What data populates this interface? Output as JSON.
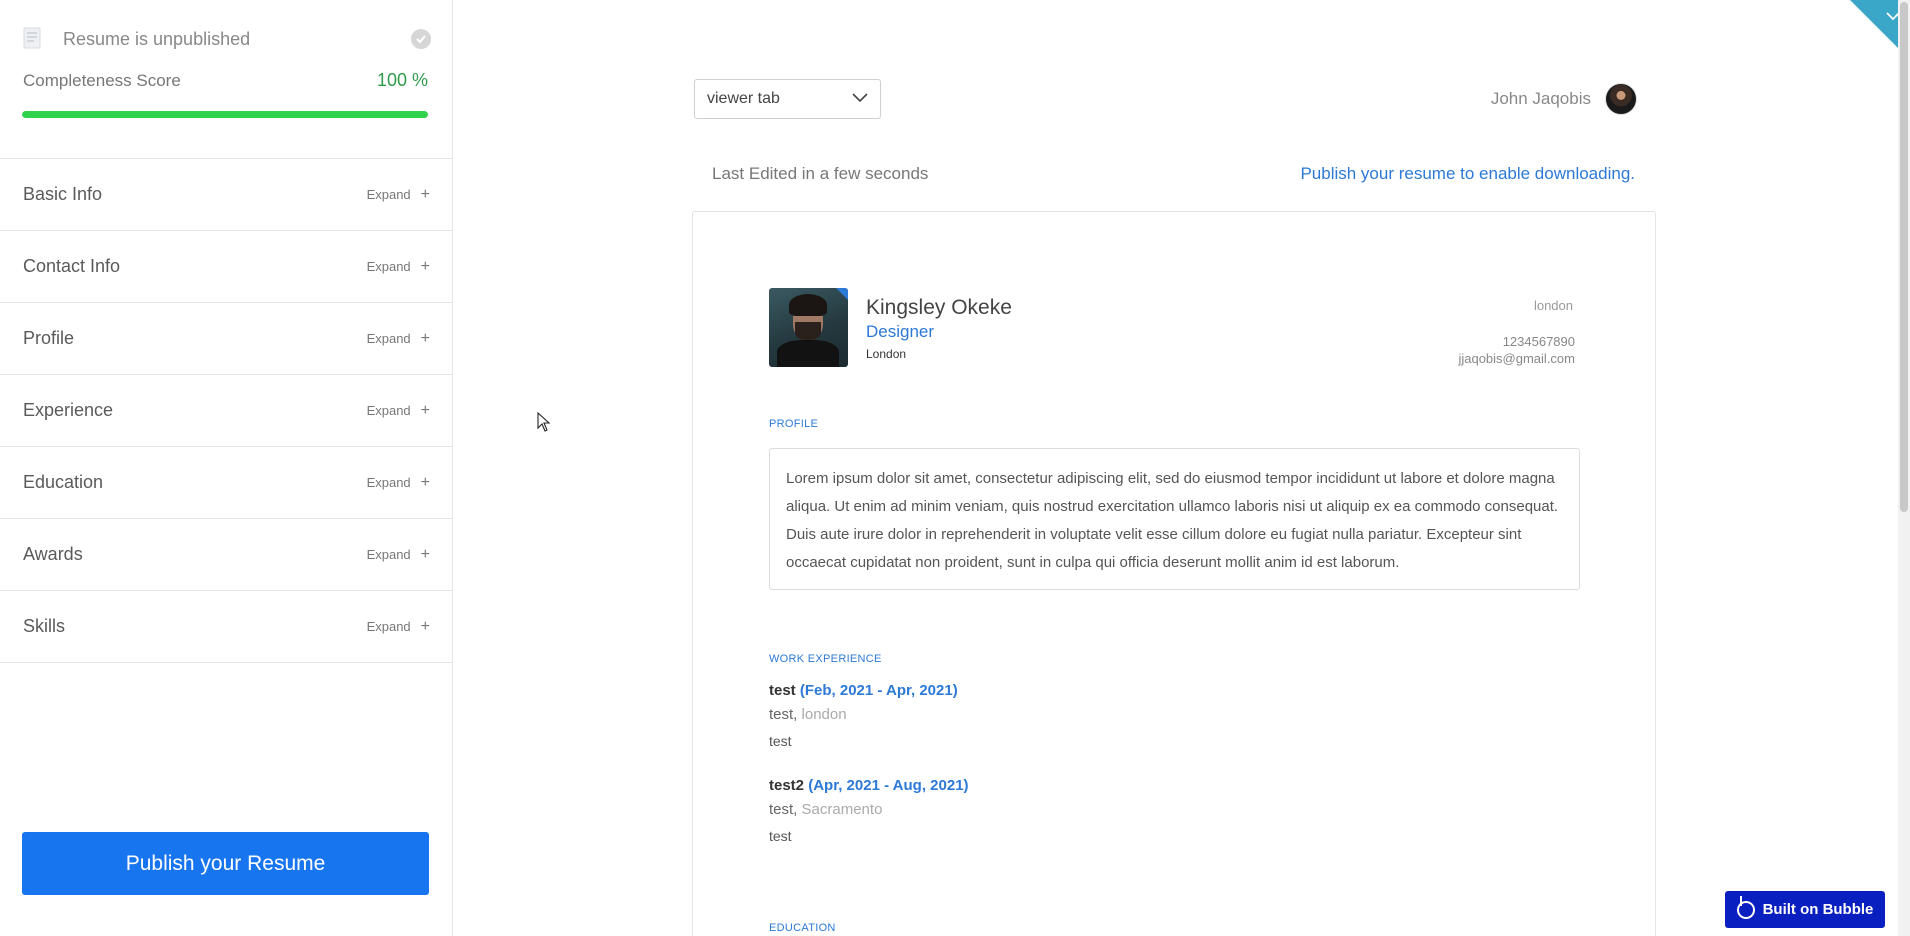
{
  "sidebar": {
    "status_text": "Resume is unpublished",
    "score_label": "Completeness Score",
    "score_value": "100 %",
    "score_fraction": 1.0,
    "sections": [
      {
        "label": "Basic Info",
        "expand": "Expand"
      },
      {
        "label": "Contact Info",
        "expand": "Expand"
      },
      {
        "label": "Profile",
        "expand": "Expand"
      },
      {
        "label": "Experience",
        "expand": "Expand"
      },
      {
        "label": "Education",
        "expand": "Expand"
      },
      {
        "label": "Awards",
        "expand": "Expand"
      },
      {
        "label": "Skills",
        "expand": "Expand"
      }
    ],
    "publish_button": "Publish your Resume"
  },
  "header": {
    "viewer_select": "viewer tab",
    "user_name": "John Jaqobis",
    "last_edited": "Last Edited in a few seconds",
    "publish_hint": "Publish your resume to enable downloading."
  },
  "resume": {
    "name": "Kingsley Okeke",
    "title": "Designer",
    "city": "London",
    "contact": {
      "city": "london",
      "phone": "1234567890",
      "email": "jjaqobis@gmail.com"
    },
    "profile_heading": "PROFILE",
    "profile_text": "Lorem ipsum dolor sit amet, consectetur adipiscing elit, sed do eiusmod tempor incididunt ut labore et dolore magna aliqua. Ut enim ad minim veniam, quis nostrud exercitation ullamco laboris nisi ut aliquip ex ea commodo consequat. Duis aute irure dolor in reprehenderit in voluptate velit esse cillum dolore eu fugiat nulla pariatur. Excepteur sint occaecat cupidatat non proident, sunt in culpa qui officia deserunt mollit anim id est laborum.",
    "work_heading": "WORK EXPERIENCE",
    "jobs": [
      {
        "title": "test",
        "dates": "(Feb, 2021 - Apr, 2021)",
        "company": "test,",
        "location": "london",
        "description": "test"
      },
      {
        "title": "test2",
        "dates": "(Apr, 2021 - Aug, 2021)",
        "company": "test,",
        "location": "Sacramento",
        "description": "test"
      }
    ],
    "education_heading": "EDUCATION"
  },
  "badge": {
    "label": "Built on Bubble"
  },
  "colors": {
    "accent": "#2c79d6",
    "primary_button": "#1775f0",
    "progress": "#2fd34c",
    "score_text": "#2e9b4b",
    "badge": "#0a1fbf",
    "corner_tab": "#3aa7c9"
  },
  "icons": [
    "document-icon",
    "check-circle-icon",
    "plus-icon",
    "chevron-down-icon",
    "user-avatar",
    "bubble-logo-icon",
    "mouse-cursor-icon"
  ]
}
